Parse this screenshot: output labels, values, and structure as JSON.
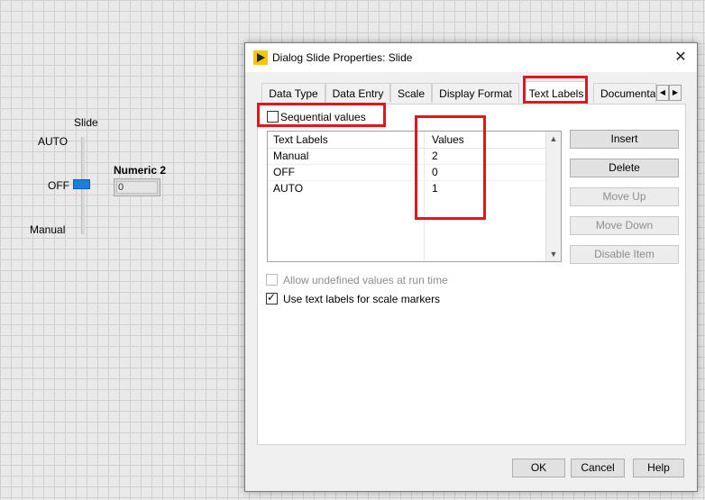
{
  "front_panel": {
    "slide_label": "Slide",
    "scale": {
      "top": "AUTO",
      "middle": "OFF",
      "bottom": "Manual"
    },
    "numeric_label": "Numeric 2",
    "numeric_value": "0",
    "slide_color": "#1a7fe0"
  },
  "dialog": {
    "title": "Dialog Slide Properties: Slide",
    "close_glyph": "✕",
    "tabs": [
      "Data Type",
      "Data Entry",
      "Scale",
      "Display Format",
      "Text Labels",
      "Documenta"
    ],
    "active_tab": "Text Labels",
    "sequential_values_label": "Sequential values",
    "table": {
      "headers": [
        "Text Labels",
        "Values"
      ],
      "rows": [
        {
          "label": "Manual",
          "value": "2"
        },
        {
          "label": "OFF",
          "value": "0"
        },
        {
          "label": "AUTO",
          "value": "1"
        }
      ]
    },
    "side_buttons": {
      "insert": "Insert",
      "delete": "Delete",
      "move_up": "Move Up",
      "move_down": "Move Down",
      "disable_item": "Disable Item"
    },
    "allow_undefined_label": "Allow undefined values at run time",
    "use_text_labels_label": "Use text labels for scale markers",
    "footer": {
      "ok": "OK",
      "cancel": "Cancel",
      "help": "Help"
    }
  },
  "colors": {
    "highlight": "#e8121d",
    "accent": "#1a7fe0"
  }
}
